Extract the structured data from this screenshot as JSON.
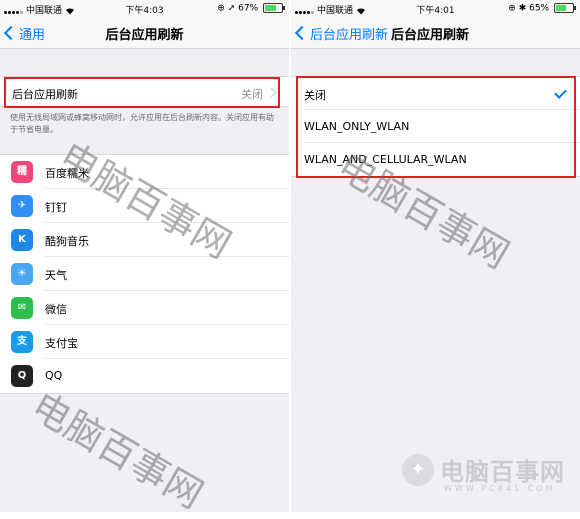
{
  "left": {
    "status": {
      "carrier": "中国联通",
      "time": "下午4:03",
      "battery": "67%",
      "battery_level": 0.67
    },
    "nav": {
      "back_label": "通用",
      "title": "后台应用刷新"
    },
    "setting": {
      "label": "后台应用刷新",
      "value": "关闭"
    },
    "footer": "使用无线局域网或蜂窝移动网时，允许应用在后台刷新内容。关闭应用有助于节省电量。",
    "apps": [
      {
        "name": "百度糯米",
        "icon": "baidu-nuomi-icon",
        "glyph": "糯",
        "color": "#f0457a"
      },
      {
        "name": "钉钉",
        "icon": "dingtalk-icon",
        "glyph": "✈",
        "color": "#2f8ff5"
      },
      {
        "name": "酷狗音乐",
        "icon": "kugou-music-icon",
        "glyph": "K",
        "color": "#1e88e5"
      },
      {
        "name": "天气",
        "icon": "weather-icon",
        "glyph": "☀",
        "color": "#4aa8f2"
      },
      {
        "name": "微信",
        "icon": "wechat-icon",
        "glyph": "✉",
        "color": "#2dbd4d"
      },
      {
        "name": "支付宝",
        "icon": "alipay-icon",
        "glyph": "支",
        "color": "#1a9be8"
      },
      {
        "name": "QQ",
        "icon": "qq-icon",
        "glyph": "Q",
        "color": "#222222"
      }
    ]
  },
  "right": {
    "status": {
      "carrier": "中国联通",
      "time": "下午4:01",
      "battery": "65%",
      "battery_level": 0.65
    },
    "nav": {
      "back_label": "后台应用刷新",
      "title": "后台应用刷新"
    },
    "options": [
      {
        "label": "关闭",
        "selected": true
      },
      {
        "label": "WLAN_ONLY_WLAN",
        "selected": false
      },
      {
        "label": "WLAN_AND_CELLULAR_WLAN",
        "selected": false
      }
    ]
  },
  "watermark": {
    "text": "电脑百事网",
    "site_brand": "电脑百事网",
    "site_url": "WWW.PC841.COM"
  },
  "colors": {
    "accent": "#007aff",
    "highlight_box": "#e02020",
    "background": "#efeff4"
  }
}
